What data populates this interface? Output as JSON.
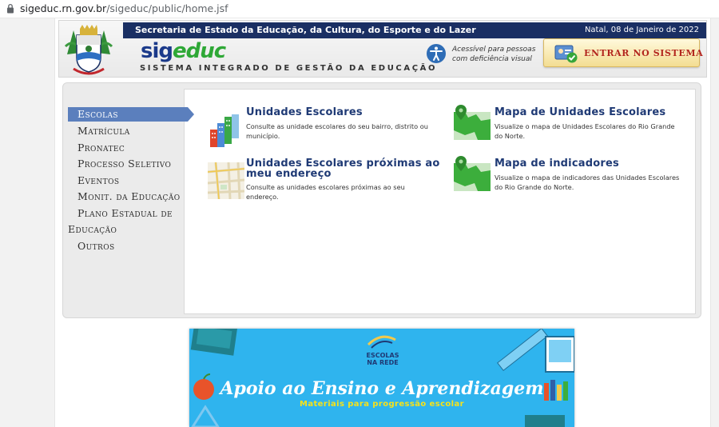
{
  "browser": {
    "url_host": "sigeduc.rn.gov.br",
    "url_path": "/sigeduc/public/home.jsf"
  },
  "header": {
    "secretaria": "Secretaria de Estado da Educação, da Cultura, do Esporte e do Lazer",
    "date": "Natal, 08 de Janeiro de 2022",
    "logo_sig": "sig",
    "logo_educ": "educ",
    "logo_subtitle": "SISTEMA INTEGRADO DE GESTÃO DA EDUCAÇÃO",
    "accessibility_line1": "Acessível para pessoas",
    "accessibility_line2": "com deficiência visual",
    "login_label": "ENTRAR NO SISTEMA"
  },
  "menu": {
    "active": "Escolas",
    "items": [
      "Matrícula",
      "Pronatec",
      "Processo Seletivo",
      "Eventos",
      "Monit. da Educação",
      "Plano Estadual de",
      "Educação",
      "Outros"
    ]
  },
  "links": [
    {
      "title": "Unidades Escolares",
      "title_line2": "",
      "desc_line1": "Consulte as unidade escolares do seu bairro, distrito ou",
      "desc_line2": "município."
    },
    {
      "title": "Mapa de Unidades Escolares",
      "title_line2": "",
      "desc_line1": "Visualize o mapa de Unidades Escolares do Rio Grande",
      "desc_line2": "do Norte."
    },
    {
      "title": "Unidades Escolares próximas ao",
      "title_line2": "meu endereço",
      "desc_line1": "Consulte as unidades escolares próximas ao seu",
      "desc_line2": "endereço."
    },
    {
      "title": "Mapa de indicadores",
      "title_line2": "",
      "desc_line1": "Visualize o mapa de indicadores das Unidades Escolares",
      "desc_line2": "do Rio Grande do Norte."
    }
  ],
  "banner": {
    "brand_line1": "ESCOLAS",
    "brand_line2": "NA REDE",
    "title": "Apoio ao Ensino e Aprendizagem",
    "subtitle": "Materiais para progressão escolar"
  },
  "colors": {
    "header_band": "#1a2f63",
    "menu_active": "#5b7fbd",
    "link_title": "#1f3a75",
    "login_text": "#b3261e",
    "banner_bg": "#2fb4ee",
    "banner_subtitle": "#f6e21a"
  }
}
